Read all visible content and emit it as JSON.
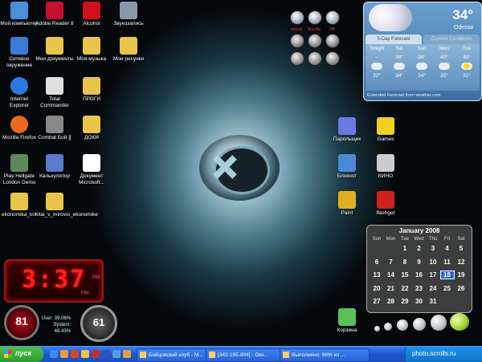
{
  "desktop_icons": [
    {
      "label": "Мой компьютер",
      "color": "#4a8fd8"
    },
    {
      "label": "Adobe Reader 8",
      "color": "#c8102e"
    },
    {
      "label": "Alcohol",
      "color": "#d0101a"
    },
    {
      "label": "Звукозапись",
      "color": "#8899aa"
    },
    {
      "label": "Сетевое окружение",
      "color": "#3a7bd5"
    },
    {
      "label": "Мои документы",
      "color": "#e8c44a"
    },
    {
      "label": "Моя музыка",
      "color": "#e8c44a"
    },
    {
      "label": "Мои рисунки",
      "color": "#e8c44a"
    },
    {
      "label": "Internet Explorer",
      "color": "#2a7be0"
    },
    {
      "label": "Total Commander",
      "color": "#e0e0e0"
    },
    {
      "label": "ПРОГИ",
      "color": "#e8c44a"
    },
    {
      "label": "Mozilla Firefox",
      "color": "#e86a1a"
    },
    {
      "label": "Combat Бой ][",
      "color": "#888888"
    },
    {
      "label": "ДОКИ",
      "color": "#e8c44a"
    },
    {
      "label": "Play Hellgate London Demo",
      "color": "#5a8a5a"
    },
    {
      "label": "Калькулятор",
      "color": "#5a7ad0"
    },
    {
      "label": "Документ Microsoft...",
      "color": "#ffffff"
    },
    {
      "label": "ekonomika_knr",
      "color": "#e8c44a"
    },
    {
      "label": "kitai_v_mirovoi_ekonomike",
      "color": "#e8c44a"
    },
    {
      "label": "Парольщик",
      "color": "#6a7ae0"
    },
    {
      "label": "Games",
      "color": "#f0d020"
    },
    {
      "label": "Блокнот",
      "color": "#4a8ad8"
    },
    {
      "label": "КИНО",
      "color": "#cccccc"
    },
    {
      "label": "Paint",
      "color": "#e0b020"
    },
    {
      "label": "flashget",
      "color": "#d02020"
    },
    {
      "label": "Корзина",
      "color": "#5ac05a"
    }
  ],
  "launcher": {
    "captions": [
      "reboot",
      "Mozilla",
      "Off"
    ]
  },
  "weather": {
    "temp": "34°",
    "city": "Odessa",
    "tab_forecast": "5-Day Forecast",
    "tab_conditions": "Current Conditions",
    "days": [
      {
        "day": "Tonight",
        "high": "--",
        "low": "32°",
        "icon": "cloud-icon"
      },
      {
        "day": "Sat",
        "high": "38°",
        "low": "34°",
        "icon": "cloud-icon"
      },
      {
        "day": "Sun",
        "high": "38°",
        "low": "34°",
        "icon": "rain-icon"
      },
      {
        "day": "Mon",
        "high": "40°",
        "low": "35°",
        "icon": "rain-icon"
      },
      {
        "day": "Tue",
        "high": "40°",
        "low": "31°",
        "icon": "sun-cloud-icon"
      }
    ],
    "footer": "Extended Forecast from weather.com"
  },
  "clock": {
    "time": "3:37",
    "ampm": "PM",
    "day": "FRI"
  },
  "system": {
    "cpu": "81",
    "mem": "61",
    "user": "User: 39.06%",
    "sys": "System: 48.43%"
  },
  "calendar": {
    "title": "January 2008",
    "weekdays": [
      "Sun",
      "Mon",
      "Tue",
      "Wed",
      "Thu",
      "Fri",
      "Sat"
    ],
    "weeks": [
      [
        "",
        "",
        "1",
        "2",
        "3",
        "4",
        "5"
      ],
      [
        "6",
        "7",
        "8",
        "9",
        "10",
        "11",
        "12"
      ],
      [
        "13",
        "14",
        "15",
        "16",
        "17",
        "18",
        "19"
      ],
      [
        "20",
        "21",
        "22",
        "23",
        "24",
        "25",
        "26"
      ],
      [
        "27",
        "28",
        "29",
        "30",
        "31",
        "",
        ""
      ]
    ],
    "today": "18"
  },
  "taskbar": {
    "start_label": "пуск",
    "tasks": [
      {
        "label": "Бойцовский клуб - М..."
      },
      {
        "label": "[342-195-804] - Окн..."
      },
      {
        "label": "Выполнено: 86% из ..."
      }
    ],
    "tray_text": "photo.scrolls.ru"
  }
}
